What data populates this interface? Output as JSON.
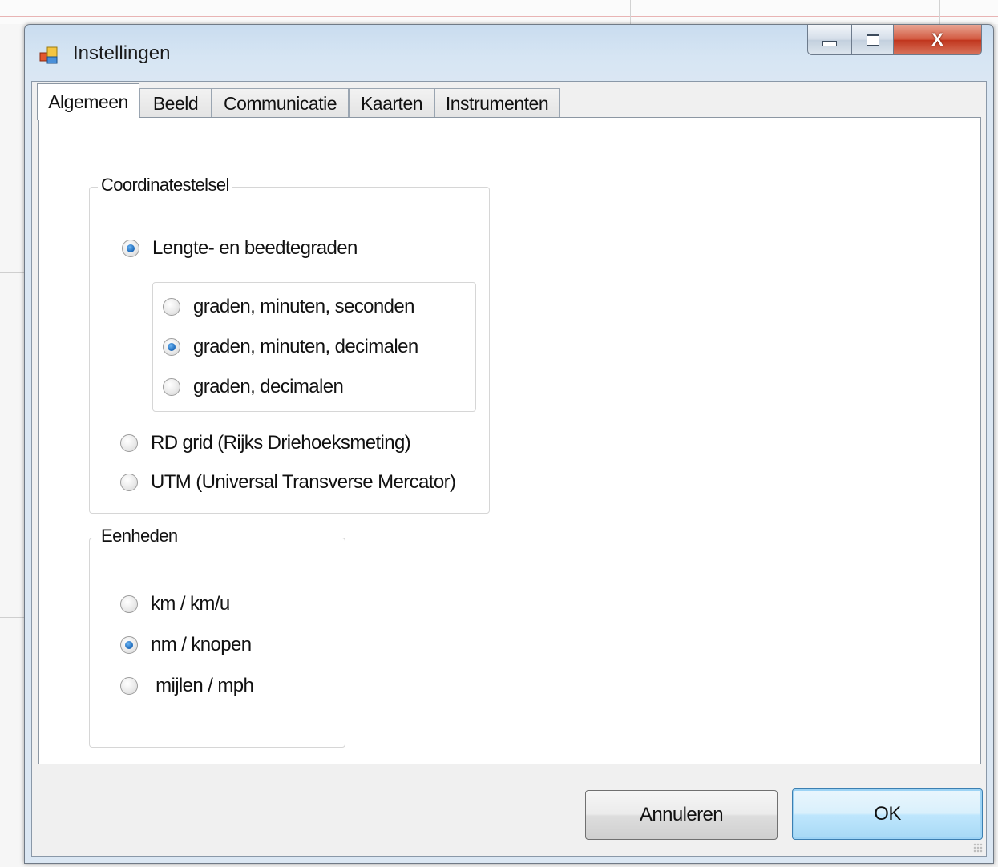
{
  "window": {
    "title": "Instellingen",
    "close_glyph": "X",
    "icons": {
      "app": "settings-app-icon",
      "minimize": "minimize-icon",
      "maximize": "maximize-icon",
      "close": "close-icon"
    }
  },
  "tabs": [
    {
      "label": "Algemeen",
      "active": true
    },
    {
      "label": "Beeld",
      "active": false
    },
    {
      "label": "Communicatie",
      "active": false
    },
    {
      "label": "Kaarten",
      "active": false
    },
    {
      "label": "Instrumenten",
      "active": false
    }
  ],
  "coordinate_group": {
    "legend": "Coordinatestelsel",
    "options": [
      {
        "label": "Lengte- en beedtegraden",
        "checked": true
      },
      {
        "label": "RD grid (Rijks Driehoeksmeting)",
        "checked": false
      },
      {
        "label": "UTM (Universal Transverse Mercator)",
        "checked": false
      }
    ],
    "format_options": [
      {
        "label": "graden, minuten, seconden",
        "checked": false
      },
      {
        "label": "graden, minuten, decimalen",
        "checked": true
      },
      {
        "label": "graden, decimalen",
        "checked": false
      }
    ]
  },
  "units_group": {
    "legend": "Eenheden",
    "options": [
      {
        "label": "km / km/u",
        "checked": false
      },
      {
        "label": "nm / knopen",
        "checked": true
      },
      {
        "label": " mijlen / mph",
        "checked": false
      }
    ]
  },
  "buttons": {
    "cancel": "Annuleren",
    "ok": "OK"
  },
  "colors": {
    "radio_checked": "#1b67b8",
    "close_button": "#c0341c",
    "default_button": "#bee6fd"
  }
}
